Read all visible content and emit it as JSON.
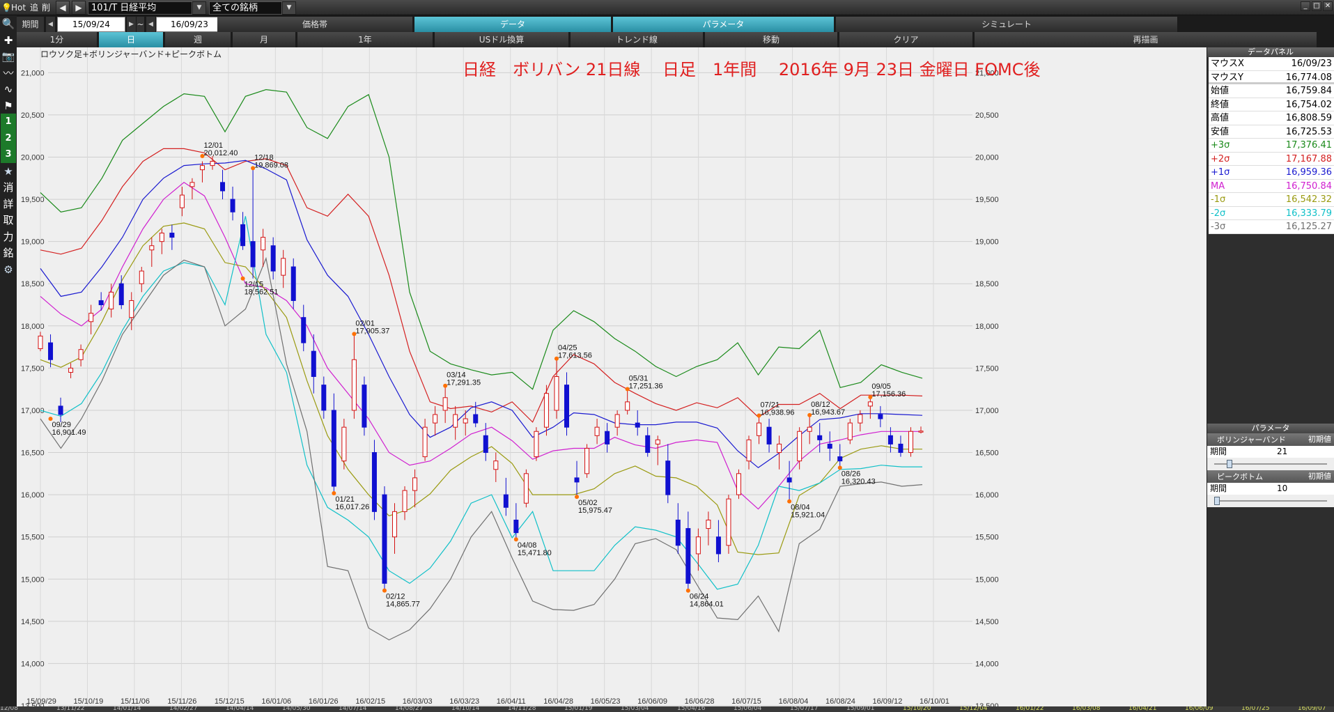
{
  "toolbar": {
    "hot": "Hot",
    "add": "追",
    "del": "削",
    "symbol": "101/T 日経平均",
    "universe": "全ての銘柄",
    "period_label": "期間",
    "date_from": "15/09/24",
    "tilde": "~",
    "date_to": "16/09/23"
  },
  "tabs_row2": [
    "価格帯",
    "データ",
    "パラメータ",
    "シミュレート"
  ],
  "tabs_row2_active": [
    1,
    2
  ],
  "tabs_row3": [
    "1分",
    "日",
    "週",
    "月",
    "1年",
    "USドル換算",
    "トレンド線",
    "移動",
    "クリア",
    "再描画"
  ],
  "tabs_row3_active": [
    1
  ],
  "left_icons": [
    "search-icon",
    "crosshair-icon",
    "camera-icon",
    "line-chart-icon",
    "trend-icon",
    "flag-icon",
    "1",
    "2",
    "3",
    "star-icon",
    "消",
    "詳",
    "取",
    "力",
    "銘",
    "gear-icon"
  ],
  "chart_data": {
    "type": "line",
    "title": "日経　ボリバン 21日線　 日足　1年間　 2016年 9月 23日 金曜日 FOMC後",
    "subtitle": "ロウソク足+ボリンジャーバンド+ピークボトム",
    "ylim": [
      13500,
      21300
    ],
    "y_ticks": [
      "21,000",
      "20,500",
      "20,000",
      "19,500",
      "19,000",
      "18,500",
      "18,000",
      "17,500",
      "17,000",
      "16,500",
      "16,000",
      "15,500",
      "15,000",
      "14,500",
      "14,000",
      "13,500"
    ],
    "x_ticks": [
      "15/09/29",
      "15/10/19",
      "15/11/06",
      "15/11/26",
      "15/12/15",
      "16/01/06",
      "16/01/26",
      "16/02/15",
      "16/03/03",
      "16/03/23",
      "16/04/11",
      "16/04/28",
      "16/05/23",
      "16/06/09",
      "16/06/28",
      "16/07/15",
      "16/08/04",
      "16/08/24",
      "16/09/12",
      "16/10/01"
    ],
    "series_colors": {
      "p3": "#1a8a1a",
      "p2": "#d42020",
      "p1": "#1a1ad0",
      "ma": "#d020d0",
      "m1": "#9a9a10",
      "m2": "#10c0c8",
      "m3": "#707070"
    },
    "bands": {
      "p3": [
        19580,
        19350,
        19400,
        19750,
        20200,
        20400,
        20600,
        20750,
        20720,
        20300,
        20720,
        20800,
        20770,
        20350,
        20220,
        20600,
        20740,
        20000,
        18400,
        17700,
        17550,
        17480,
        17420,
        17450,
        17250,
        17950,
        18180,
        18050,
        17850,
        17700,
        17520,
        17400,
        17520,
        17600,
        17800,
        17420,
        17750,
        17730,
        17950,
        17270,
        17330,
        17540,
        17450,
        17380
      ],
      "p2": [
        18900,
        18850,
        18920,
        19250,
        19650,
        19950,
        20100,
        20100,
        20050,
        19850,
        19950,
        19980,
        19900,
        19400,
        19300,
        19560,
        19300,
        18600,
        17700,
        17100,
        17020,
        17050,
        16980,
        17100,
        16860,
        17400,
        17660,
        17550,
        17330,
        17200,
        17080,
        17000,
        17090,
        17030,
        17150,
        16920,
        17070,
        17070,
        17200,
        17020,
        17180,
        17180,
        17180,
        17170
      ],
      "p1": [
        18680,
        18350,
        18400,
        18700,
        19050,
        19500,
        19750,
        19900,
        19920,
        19930,
        19960,
        19860,
        19730,
        19020,
        18600,
        18350,
        17900,
        17400,
        16950,
        16680,
        16800,
        17030,
        17100,
        17000,
        16680,
        16800,
        16970,
        16950,
        16850,
        16830,
        16830,
        16860,
        16860,
        16790,
        16520,
        16320,
        16490,
        16700,
        16890,
        16910,
        16960,
        16960,
        16950,
        16940
      ],
      "ma": [
        18350,
        18140,
        18000,
        18200,
        18700,
        19150,
        19500,
        19700,
        19540,
        19050,
        18500,
        18450,
        18300,
        18000,
        17500,
        17200,
        16900,
        16500,
        16350,
        16400,
        16550,
        16720,
        16800,
        16640,
        16420,
        16520,
        16550,
        16550,
        16680,
        16590,
        16550,
        16620,
        16650,
        16620,
        16050,
        15830,
        16100,
        16400,
        16600,
        16650,
        16710,
        16750,
        16750,
        16750
      ],
      "m1": [
        17600,
        17510,
        17630,
        18050,
        18550,
        18950,
        19180,
        19220,
        19150,
        18750,
        18700,
        18420,
        18100,
        17350,
        16700,
        16300,
        16000,
        15750,
        15830,
        16010,
        16290,
        16450,
        16570,
        16370,
        16000,
        16000,
        16000,
        16070,
        16250,
        16340,
        16220,
        16200,
        16100,
        15880,
        15320,
        15290,
        15310,
        15990,
        16140,
        16430,
        16540,
        16580,
        16540,
        16540
      ],
      "m2": [
        17000,
        16930,
        17080,
        17450,
        17950,
        18350,
        18650,
        18750,
        18700,
        18250,
        19300,
        17900,
        17450,
        16350,
        15850,
        15700,
        15500,
        15100,
        14950,
        15130,
        15450,
        15900,
        16000,
        15490,
        15800,
        15100,
        15100,
        15100,
        15400,
        15620,
        15580,
        15500,
        15200,
        14880,
        14940,
        15400,
        16100,
        16050,
        16140,
        16300,
        16310,
        16350,
        16330,
        16330
      ],
      "m3": [
        16900,
        16550,
        16900,
        17350,
        17900,
        18250,
        18600,
        18780,
        18700,
        18000,
        18200,
        18800,
        17550,
        16750,
        15150,
        15100,
        14420,
        14280,
        14400,
        14650,
        15000,
        15500,
        15800,
        15250,
        14740,
        14640,
        14630,
        14700,
        15000,
        15420,
        15480,
        15350,
        14940,
        14540,
        14520,
        14800,
        14380,
        15420,
        15590,
        16100,
        16130,
        16150,
        16100,
        16120
      ]
    },
    "annotations": [
      {
        "d": "09/29",
        "v": "16,901.49",
        "i": 1,
        "y": 16900
      },
      {
        "d": "12/01",
        "v": "20,012.40",
        "i": 16,
        "y": 20012
      },
      {
        "d": "12/18",
        "v": "19,869.08",
        "i": 21,
        "y": 19869
      },
      {
        "d": "12/15",
        "v": "18,562.51",
        "i": 20,
        "y": 18562
      },
      {
        "d": "02/01",
        "v": "17,905.37",
        "i": 31,
        "y": 17905
      },
      {
        "d": "01/21",
        "v": "16,017.26",
        "i": 29,
        "y": 16017
      },
      {
        "d": "02/12",
        "v": "14,865.77",
        "i": 34,
        "y": 14865
      },
      {
        "d": "03/14",
        "v": "17,291.35",
        "i": 40,
        "y": 17291
      },
      {
        "d": "04/08",
        "v": "15,471.80",
        "i": 47,
        "y": 15471
      },
      {
        "d": "04/25",
        "v": "17,613.56",
        "i": 51,
        "y": 17613
      },
      {
        "d": "05/02",
        "v": "15,975.47",
        "i": 53,
        "y": 15975
      },
      {
        "d": "05/31",
        "v": "17,251.36",
        "i": 58,
        "y": 17251
      },
      {
        "d": "06/24",
        "v": "14,864.01",
        "i": 64,
        "y": 14864
      },
      {
        "d": "07/21",
        "v": "16,938.96",
        "i": 71,
        "y": 16938
      },
      {
        "d": "08/04",
        "v": "15,921.04",
        "i": 74,
        "y": 15921
      },
      {
        "d": "08/12",
        "v": "16,943.67",
        "i": 76,
        "y": 16943
      },
      {
        "d": "08/26",
        "v": "16,320.43",
        "i": 79,
        "y": 16320
      },
      {
        "d": "09/05",
        "v": "17,156.36",
        "i": 82,
        "y": 17156
      }
    ],
    "candles": [
      [
        17730,
        17930,
        17700,
        17880
      ],
      [
        17800,
        17900,
        17510,
        17600
      ],
      [
        17050,
        17150,
        16860,
        16950
      ],
      [
        17450,
        17560,
        17380,
        17500
      ],
      [
        17600,
        17780,
        17520,
        17720
      ],
      [
        18050,
        18250,
        17900,
        18150
      ],
      [
        18300,
        18400,
        18180,
        18250
      ],
      [
        18200,
        18500,
        18100,
        18400
      ],
      [
        18500,
        18600,
        18200,
        18250
      ],
      [
        18100,
        18400,
        17950,
        18300
      ],
      [
        18500,
        18700,
        18400,
        18650
      ],
      [
        18900,
        19050,
        18700,
        18950
      ],
      [
        19000,
        19150,
        18850,
        19100
      ],
      [
        19100,
        19200,
        18900,
        19050
      ],
      [
        19400,
        19650,
        19300,
        19550
      ],
      [
        19650,
        19750,
        19500,
        19700
      ],
      [
        19850,
        19950,
        19700,
        19900
      ],
      [
        19900,
        20012,
        19850,
        19950
      ],
      [
        19700,
        19850,
        19500,
        19600
      ],
      [
        19500,
        19650,
        19250,
        19350
      ],
      [
        19200,
        19350,
        18900,
        18950
      ],
      [
        19000,
        19869,
        18562,
        18700
      ],
      [
        18900,
        19150,
        18700,
        19050
      ],
      [
        18950,
        19050,
        18550,
        18650
      ],
      [
        18600,
        18900,
        18450,
        18800
      ],
      [
        18700,
        18800,
        18200,
        18300
      ],
      [
        18100,
        18250,
        17700,
        17800
      ],
      [
        17700,
        17900,
        17200,
        17400
      ],
      [
        17300,
        17400,
        16900,
        17000
      ],
      [
        17000,
        17200,
        16017,
        16100
      ],
      [
        16400,
        16900,
        16300,
        16800
      ],
      [
        17000,
        17905,
        16900,
        17600
      ],
      [
        17300,
        17400,
        16700,
        16800
      ],
      [
        16500,
        16650,
        15700,
        15800
      ],
      [
        16000,
        16100,
        14865,
        14950
      ],
      [
        15500,
        15900,
        15300,
        15800
      ],
      [
        15800,
        16100,
        15700,
        16050
      ],
      [
        16050,
        16300,
        15850,
        16200
      ],
      [
        16450,
        16900,
        16400,
        16800
      ],
      [
        16850,
        17050,
        16700,
        16950
      ],
      [
        17000,
        17291,
        16850,
        17150
      ],
      [
        16800,
        17050,
        16650,
        16950
      ],
      [
        16850,
        17000,
        16700,
        16900
      ],
      [
        16950,
        17100,
        16800,
        16850
      ],
      [
        16700,
        16850,
        16400,
        16500
      ],
      [
        16300,
        16500,
        16150,
        16400
      ],
      [
        16000,
        16200,
        15750,
        15850
      ],
      [
        15700,
        15900,
        15471,
        15550
      ],
      [
        15900,
        16300,
        15850,
        16250
      ],
      [
        16450,
        16800,
        16400,
        16750
      ],
      [
        16800,
        17300,
        16700,
        17200
      ],
      [
        17000,
        17613,
        16900,
        17400
      ],
      [
        17300,
        17450,
        16700,
        16800
      ],
      [
        16200,
        16400,
        15975,
        16150
      ],
      [
        16250,
        16600,
        16200,
        16550
      ],
      [
        16700,
        16900,
        16600,
        16800
      ],
      [
        16750,
        16850,
        16500,
        16600
      ],
      [
        16800,
        17000,
        16700,
        16950
      ],
      [
        17000,
        17251,
        16950,
        17100
      ],
      [
        16850,
        17000,
        16700,
        16800
      ],
      [
        16700,
        16800,
        16450,
        16500
      ],
      [
        16600,
        16700,
        16350,
        16650
      ],
      [
        16400,
        16600,
        15900,
        16000
      ],
      [
        15700,
        15900,
        15300,
        15400
      ],
      [
        15600,
        15800,
        14864,
        14950
      ],
      [
        15300,
        15600,
        15100,
        15500
      ],
      [
        15600,
        15800,
        15400,
        15700
      ],
      [
        15500,
        15700,
        15200,
        15300
      ],
      [
        15400,
        16000,
        15300,
        15950
      ],
      [
        16000,
        16300,
        15950,
        16250
      ],
      [
        16400,
        16700,
        16300,
        16650
      ],
      [
        16700,
        16938,
        16600,
        16850
      ],
      [
        16800,
        16900,
        16500,
        16600
      ],
      [
        16500,
        16700,
        16300,
        16600
      ],
      [
        16200,
        16400,
        15921,
        16150
      ],
      [
        16400,
        16800,
        16300,
        16750
      ],
      [
        16750,
        16943,
        16600,
        16800
      ],
      [
        16700,
        16850,
        16500,
        16650
      ],
      [
        16600,
        16750,
        16400,
        16550
      ],
      [
        16450,
        16600,
        16320,
        16400
      ],
      [
        16650,
        16900,
        16600,
        16850
      ],
      [
        16850,
        17000,
        16750,
        16950
      ],
      [
        17050,
        17156,
        16900,
        17100
      ],
      [
        16950,
        17050,
        16800,
        16900
      ],
      [
        16700,
        16800,
        16500,
        16600
      ],
      [
        16600,
        16700,
        16450,
        16500
      ],
      [
        16500,
        16800,
        16450,
        16750
      ],
      [
        16750,
        16808,
        16725,
        16754
      ]
    ]
  },
  "panel": {
    "title": "データパネル",
    "rows": [
      {
        "k": "マウスX",
        "v": "16/09/23",
        "c": "#000"
      },
      {
        "k": "マウスY",
        "v": "16,774.08",
        "c": "#000"
      },
      {
        "k": "始値",
        "v": "16,759.84",
        "c": "#000"
      },
      {
        "k": "終値",
        "v": "16,754.02",
        "c": "#000"
      },
      {
        "k": "高値",
        "v": "16,808.59",
        "c": "#000"
      },
      {
        "k": "安値",
        "v": "16,725.53",
        "c": "#000"
      },
      {
        "k": "+3σ",
        "v": "17,376.41",
        "c": "#1a8a1a"
      },
      {
        "k": "+2σ",
        "v": "17,167.88",
        "c": "#d42020"
      },
      {
        "k": "+1σ",
        "v": "16,959.36",
        "c": "#1a1ad0"
      },
      {
        "k": "MA",
        "v": "16,750.84",
        "c": "#d020d0"
      },
      {
        "k": "-1σ",
        "v": "16,542.32",
        "c": "#9a9a10"
      },
      {
        "k": "-2σ",
        "v": "16,333.79",
        "c": "#10c0c8"
      },
      {
        "k": "-3σ",
        "v": "16,125.27",
        "c": "#707070"
      }
    ],
    "param_title": "パラメータ",
    "bb_title": "ボリンジャーバンド",
    "bb_reset": "初期値",
    "bb_key": "期間",
    "bb_val": "21",
    "bb_level": 0.12,
    "pb_title": "ピークボトム",
    "pb_reset": "初期値",
    "pb_key": "期間",
    "pb_val": "10",
    "pb_level": 0.0
  },
  "bottom_dates": [
    "12/08",
    "13/11/22",
    "14/01/14",
    "14/02/27",
    "14/04/14",
    "14/05/30",
    "14/07/14",
    "14/08/27",
    "14/10/14",
    "14/11/28",
    "15/01/19",
    "15/03/04",
    "15/04/16",
    "15/06/04",
    "15/07/17",
    "15/09/01",
    "15/10/20",
    "15/12/04",
    "16/01/22",
    "16/03/08",
    "16/04/21",
    "16/06/09",
    "16/07/25",
    "16/09/07"
  ]
}
